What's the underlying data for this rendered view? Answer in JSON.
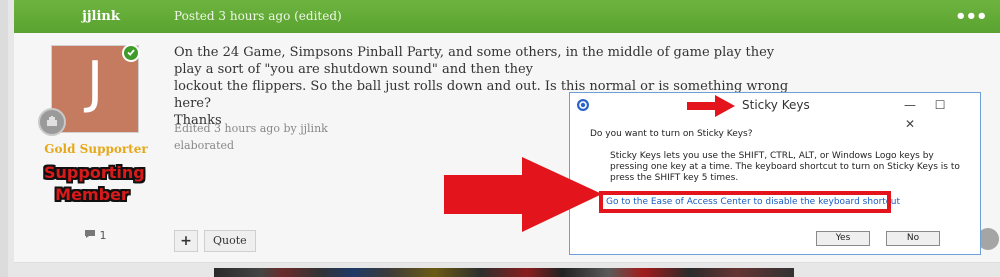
{
  "post": {
    "author": "jjlink",
    "posted": "Posted 3 hours ago (edited)",
    "more_glyph": "•••",
    "avatar_letter": "J",
    "group": "Gold Supporter",
    "badge_text": "Supporting Member",
    "reputation_count": "1",
    "content_line1": "On the 24 Game, Simpsons Pinball Party, and some others, in the middle of game play they play a sort of \"you are shutdown sound\" and then they",
    "content_line2": "lockout the flippers. So the ball just rolls down and out. Is this normal or is something wrong here?",
    "content_line3": "Thanks",
    "edited": "Edited 3 hours ago by jjlink",
    "edit_reason": "elaborated",
    "plus_label": "+",
    "quote_label": "Quote"
  },
  "dialog": {
    "title": "Sticky Keys",
    "controls": [
      "—",
      "☐",
      "✕"
    ],
    "question": "Do you want to turn on Sticky Keys?",
    "description": "Sticky Keys lets you use the SHIFT, CTRL, ALT, or Windows Logo keys by pressing one key at a time. The keyboard shortcut to turn on Sticky Keys is to press the SHIFT key 5 times.",
    "link": "Go to the Ease of Access Center to disable the keyboard shortcut",
    "yes": "Yes",
    "no": "No"
  },
  "colors": {
    "header_green": "#5aa330",
    "gold": "#e5a818",
    "highlight_red": "#e3141b",
    "link_blue": "#1a5dc5"
  },
  "icons": {
    "online": "check-icon",
    "rank": "hand-icon",
    "reputation": "comment-icon",
    "dialog": "ease-of-access-icon",
    "annotations": "red-arrow-icon"
  }
}
